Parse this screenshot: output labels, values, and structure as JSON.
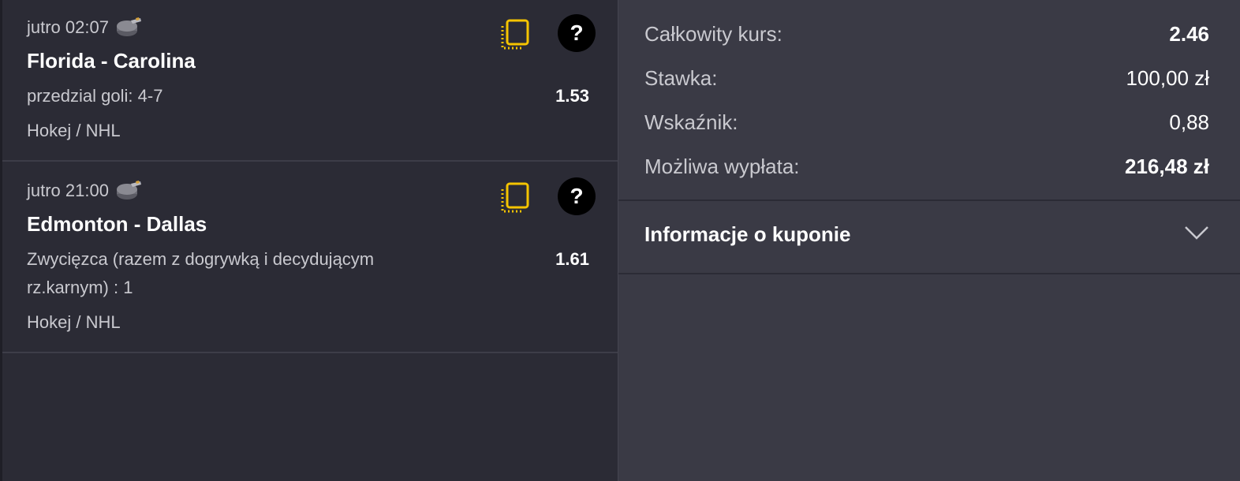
{
  "bets": [
    {
      "time": "jutro 02:07",
      "sport_icon": "hockey-puck-icon",
      "teams": "Florida - Carolina",
      "market": "przedzial goli: 4-7",
      "odd": "1.53",
      "league": "Hokej / NHL"
    },
    {
      "time": "jutro 21:00",
      "sport_icon": "hockey-puck-icon",
      "teams": "Edmonton - Dallas",
      "market": "Zwycięzca (razem z dogrywką i decydującym rz.karnym) : 1",
      "odd": "1.61",
      "league": "Hokej / NHL"
    }
  ],
  "summary": {
    "total_odds_label": "Całkowity kurs:",
    "total_odds_value": "2.46",
    "stake_label": "Stawka:",
    "stake_value": "100,00 zł",
    "indicator_label": "Wskaźnik:",
    "indicator_value": "0,88",
    "payout_label": "Możliwa wypłata:",
    "payout_value": "216,48 zł"
  },
  "coupon_info": {
    "label": "Informacje o kuponie"
  },
  "colors": {
    "accent_yellow": "#f5c400",
    "left_bg": "#2b2b35",
    "right_bg": "#3a3a45"
  }
}
